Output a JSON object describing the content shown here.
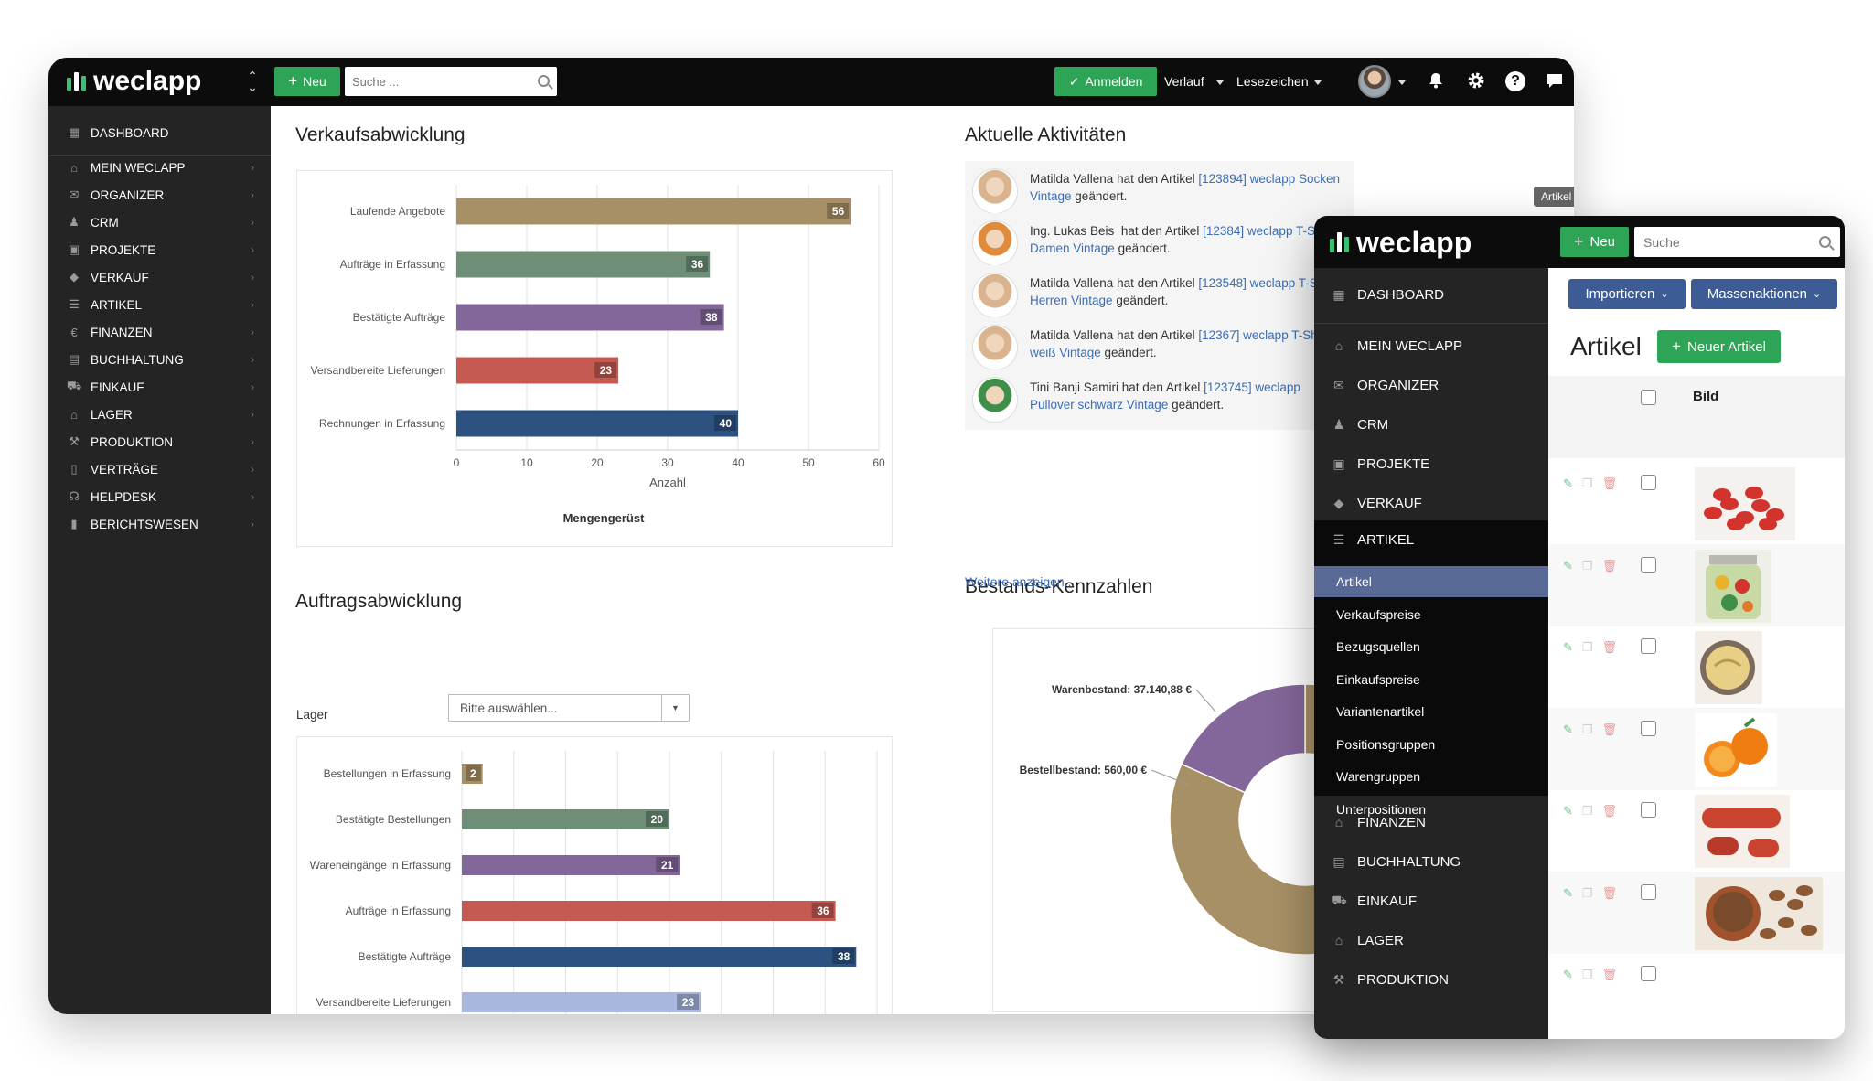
{
  "main": {
    "logo": "weclapp",
    "topbar": {
      "new_label": "Neu",
      "search_placeholder": "Suche ...",
      "login_label": "Anmelden",
      "history_label": "Verlauf",
      "bookmarks_label": "Lesezeichen"
    },
    "sidebar": {
      "dashboard": "DASHBOARD",
      "items": [
        {
          "label": "MEIN WECLAPP",
          "icon": "home-icon"
        },
        {
          "label": "ORGANIZER",
          "icon": "inbox-icon"
        },
        {
          "label": "CRM",
          "icon": "users-icon"
        },
        {
          "label": "PROJEKTE",
          "icon": "briefcase-icon"
        },
        {
          "label": "VERKAUF",
          "icon": "tag-icon"
        },
        {
          "label": "ARTIKEL",
          "icon": "list-icon"
        },
        {
          "label": "FINANZEN",
          "icon": "euro-icon"
        },
        {
          "label": "BUCHHALTUNG",
          "icon": "calculator-icon"
        },
        {
          "label": "EINKAUF",
          "icon": "cart-icon"
        },
        {
          "label": "LAGER",
          "icon": "warehouse-icon"
        },
        {
          "label": "PRODUKTION",
          "icon": "wrench-icon"
        },
        {
          "label": "VERTRÄGE",
          "icon": "document-icon"
        },
        {
          "label": "HELPDESK",
          "icon": "headset-icon"
        },
        {
          "label": "BERICHTSWESEN",
          "icon": "bar-chart-icon"
        }
      ]
    },
    "sections": {
      "sales": "Verkaufsabwicklung",
      "activities": "Aktuelle Aktivitäten",
      "orders": "Auftragsabwicklung",
      "stock": "Bestands-Kennzahlen"
    },
    "activities": [
      {
        "name": "Matilda Vallena",
        "text": " hat den Artikel ",
        "link": "[123894] weclapp Socken Vintage",
        "suffix": " geändert.",
        "avatar_color": "#d9b48f"
      },
      {
        "name": "Ing. Lukas Beis",
        "text": "  hat den Artikel ",
        "link": "[12384] weclapp T-Shirt Damen Vintage",
        "suffix": " geändert.",
        "avatar_color": "#e08a3c"
      },
      {
        "name": "Matilda Vallena",
        "text": " hat den Artikel ",
        "link": "[123548] weclapp T-Shirt Herren Vintage",
        "suffix": " geändert.",
        "avatar_color": "#d9b48f"
      },
      {
        "name": "Matilda Vallena",
        "text": " hat den Artikel ",
        "link": "[12367] weclapp T-Shirt weiß Vintage",
        "suffix": " geändert.",
        "avatar_color": "#d9b48f"
      },
      {
        "name": "Tini Banji Samiri",
        "text": " hat den Artikel ",
        "link": "[123745] weclapp Pullover schwarz Vintage",
        "suffix": " geändert.",
        "avatar_color": "#3f8f4a"
      }
    ],
    "activity_badge": "Artikel",
    "more_link": "Weitere anzeigen...",
    "lager_label": "Lager",
    "lager_placeholder": "Bitte auswählen..."
  },
  "chart_data": [
    {
      "type": "bar",
      "orientation": "horizontal",
      "categories": [
        "Laufende Angebote",
        "Aufträge in Erfassung",
        "Bestätigte Aufträge",
        "Versandbereite Lieferungen",
        "Rechnungen in Erfassung"
      ],
      "values": [
        56,
        36,
        38,
        23,
        40
      ],
      "colors": [
        "#a89066",
        "#6e8e77",
        "#83679a",
        "#c45a52",
        "#2d5282"
      ],
      "xlabel": "Anzahl",
      "title": "Mengengerüst",
      "xlim": [
        0,
        60
      ],
      "xticks": [
        0,
        10,
        20,
        30,
        40,
        50,
        60
      ],
      "grid": true
    },
    {
      "type": "bar",
      "orientation": "horizontal",
      "categories": [
        "Bestellungen in Erfassung",
        "Bestätigte Bestellungen",
        "Wareneingänge in Erfassung",
        "Aufträge in Erfassung",
        "Bestätigte Aufträge",
        "Versandbereite Lieferungen"
      ],
      "values": [
        2,
        20,
        21,
        36,
        38,
        23
      ],
      "colors": [
        "#a89066",
        "#6e8e77",
        "#83679a",
        "#c45a52",
        "#2d5282",
        "#a8b7dd"
      ],
      "xlim": [
        0,
        40
      ],
      "xticks": [
        0,
        5,
        10,
        15,
        20,
        25,
        30,
        35,
        40
      ],
      "grid": true
    },
    {
      "type": "pie",
      "donut": true,
      "labels": [
        "Warenbestand",
        "Bestellbestand"
      ],
      "display_labels": [
        "Warenbestand: 37.140,88 €",
        "Bestellbestand: 560,00 €"
      ],
      "values": [
        37140.88,
        560.0
      ],
      "colors": [
        "#a89066",
        "#83679a"
      ]
    }
  ],
  "overlay": {
    "logo": "weclapp",
    "new_label": "Neu",
    "search_placeholder": "Suche",
    "sidebar": {
      "dashboard": "DASHBOARD",
      "top_items": [
        {
          "label": "MEIN WECLAPP",
          "icon": "home-icon"
        },
        {
          "label": "ORGANIZER",
          "icon": "inbox-icon"
        },
        {
          "label": "CRM",
          "icon": "users-icon"
        },
        {
          "label": "PROJEKTE",
          "icon": "briefcase-icon"
        },
        {
          "label": "VERKAUF",
          "icon": "tag-icon"
        }
      ],
      "artikel": "ARTIKEL",
      "subitems": [
        "Artikel",
        "Verkaufspreise",
        "Bezugsquellen",
        "Einkaufspreise",
        "Variantenartikel",
        "Positionsgruppen",
        "Warengruppen",
        "Unterpositionen"
      ],
      "bottom_items": [
        {
          "label": "FINANZEN",
          "icon": "bank-icon"
        },
        {
          "label": "BUCHHALTUNG",
          "icon": "calculator-icon"
        },
        {
          "label": "EINKAUF",
          "icon": "cart-icon"
        },
        {
          "label": "LAGER",
          "icon": "warehouse-icon"
        },
        {
          "label": "PRODUKTION",
          "icon": "wrench-icon"
        }
      ]
    },
    "import_label": "Importieren",
    "mass_label": "Massenaktionen",
    "title": "Artikel",
    "new_article_label": "Neuer Artikel",
    "col_image": "Bild",
    "rows": [
      {
        "image": "dried-strawberries"
      },
      {
        "image": "pickled-vegetables-jar"
      },
      {
        "image": "hummus-bowl"
      },
      {
        "image": "oranges"
      },
      {
        "image": "sausages"
      },
      {
        "image": "nuts-bowl"
      },
      {
        "image": ""
      }
    ]
  }
}
